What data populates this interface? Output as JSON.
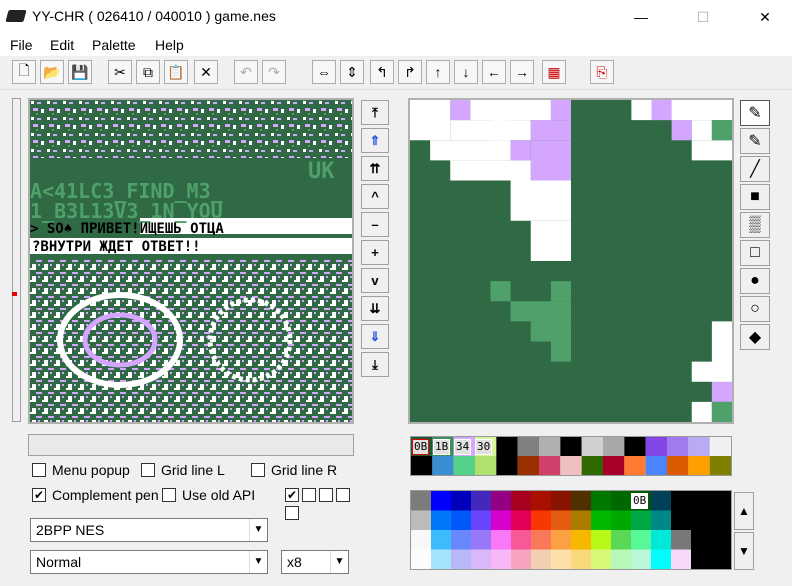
{
  "window": {
    "title": "YY-CHR ( 026410 / 040010 )  game.nes",
    "minimize": "—",
    "maximize": "☐",
    "close": "✕"
  },
  "menu": [
    "File",
    "Edit",
    "Palette",
    "Help"
  ],
  "toolbar": {
    "new": "🗋",
    "open": "📂",
    "save": "💾",
    "cut": "✂",
    "copy": "⧉",
    "paste": "📋",
    "delete": "✕",
    "undo": "↶",
    "redo": "↷",
    "flip_h": "⇔",
    "flip_v": "⇕",
    "rot_left": "↰",
    "rot_right": "↱",
    "shift_up": "↑",
    "shift_down": "↓",
    "shift_left": "←",
    "shift_right": "→",
    "palette_icon": "▦",
    "jump_icon": "⎘"
  },
  "scroll_buttons": [
    "⤒",
    "⇑",
    "⇈",
    "^",
    "–",
    "+",
    "v",
    "⇊",
    "⇓",
    "⤓"
  ],
  "tools": [
    "✎",
    "✎",
    "╱",
    "■",
    "▒",
    "□",
    "●",
    "○",
    "◆"
  ],
  "pattern_text": {
    "line1": "UK",
    "line2": "A<41LC3_FIND_M3_",
    "line3": "1_B3L13V3_1N_YOU",
    "line4": "> SO♠ ПРИВЕТ!ИЩЕШЬ ОТЦА",
    "line5": "?ВНУТРИ ЖДЕТ ОТВЕТ!!"
  },
  "options": {
    "menu_popup": {
      "label": "Menu popup",
      "checked": false
    },
    "grid_line_l": {
      "label": "Grid line L",
      "checked": false
    },
    "grid_line_r": {
      "label": "Grid line R",
      "checked": false
    },
    "complement_pen": {
      "label": "Complement pen",
      "checked": true
    },
    "use_old_api": {
      "label": "Use old API",
      "checked": false
    }
  },
  "format_select": "2BPP NES",
  "mode_select": "Normal",
  "zoom_select": "x8",
  "palette_row": {
    "labels": [
      "0B",
      "1B",
      "34",
      "30"
    ],
    "colors_top": [
      "#1b5a36",
      "#3f8f5c",
      "#d7a6ff",
      "#d5f79a",
      "#000000",
      "#808080",
      "#b0b0b0",
      "#000000",
      "#d0d0d0",
      "#a8a8a8",
      "#000000",
      "#8446e6",
      "#9f7bef",
      "#b9aaf3"
    ],
    "colors_bottom": [
      "#000000",
      "#3a8fd0",
      "#55d08a",
      "#b0e070",
      "#000000",
      "#9a3000",
      "#d0406a",
      "#f0c0c0",
      "#2e6a00",
      "#a80028",
      "#ff7a30",
      "#4a84ff",
      "#dd5a00",
      "#ffa000",
      "#808000"
    ]
  },
  "full_palette": {
    "selected_label": "0B",
    "rows": [
      [
        "#7c7c7c",
        "#0000fc",
        "#0000bc",
        "#4428bc",
        "#940084",
        "#a80020",
        "#a81000",
        "#881400",
        "#503000",
        "#007800",
        "#006800",
        "#005800",
        "#004058",
        "#000000",
        "#000000",
        "#000000"
      ],
      [
        "#bcbcbc",
        "#0078f8",
        "#0058f8",
        "#6844fc",
        "#d800cc",
        "#e40058",
        "#f83800",
        "#e45c10",
        "#ac7c00",
        "#00b800",
        "#00a800",
        "#00a844",
        "#008888",
        "#000000",
        "#000000",
        "#000000"
      ],
      [
        "#f8f8f8",
        "#3cbcfc",
        "#6888fc",
        "#9878f8",
        "#f878f8",
        "#f85898",
        "#f87858",
        "#fca044",
        "#f8b800",
        "#b8f818",
        "#58d854",
        "#58f898",
        "#00e8d8",
        "#787878",
        "#000000",
        "#000000"
      ],
      [
        "#fcfcfc",
        "#a4e4fc",
        "#b8b8f8",
        "#d8b8f8",
        "#f8b8f8",
        "#f8a4c0",
        "#f0d0b0",
        "#fce0a8",
        "#f8d878",
        "#d8f878",
        "#b8f8b8",
        "#b8f8d8",
        "#00fcfc",
        "#f8d8f8",
        "#000000",
        "#000000"
      ]
    ]
  }
}
